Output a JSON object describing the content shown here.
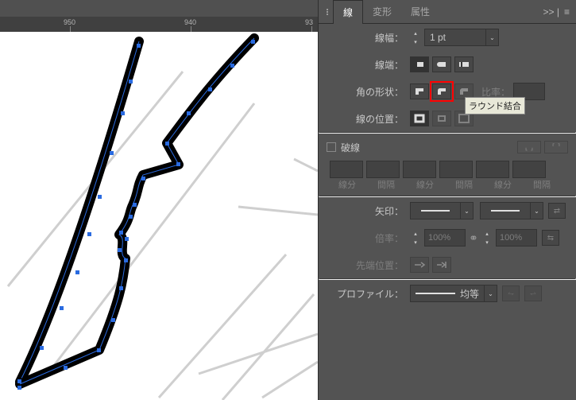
{
  "ruler": {
    "t0": "950",
    "t1": "940",
    "t2": "93"
  },
  "panel_tabs": {
    "stroke": "線",
    "transform": "変形",
    "attribute": "属性",
    "more": ">> |",
    "menu": "≡"
  },
  "stroke_panel": {
    "weight_label": "線幅：",
    "weight_value": "1 pt",
    "cap_label": "線端：",
    "corner_label": "角の形状：",
    "corner_tooltip": "ラウンド結合",
    "ratio_label": "比率：",
    "align_label": "線の位置：",
    "dashed_label": "破線",
    "dash_labels": [
      "線分",
      "間隔",
      "線分",
      "間隔",
      "線分",
      "間隔"
    ],
    "arrow_label": "矢印：",
    "scale_label": "倍率：",
    "scale_value_1": "100%",
    "scale_value_2": "100%",
    "tip_label": "先端位置：",
    "profile_label": "プロファイル：",
    "profile_value": "均等"
  }
}
